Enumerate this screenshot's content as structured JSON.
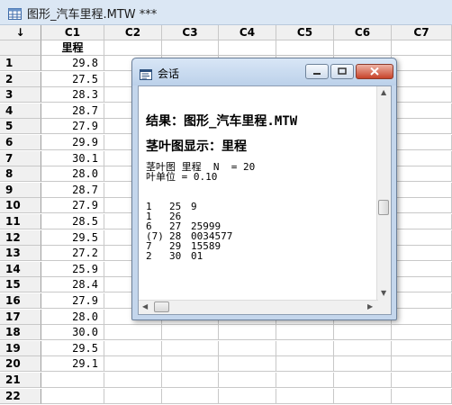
{
  "window": {
    "title": "图形_汽车里程.MTW ***"
  },
  "worksheet": {
    "corner_label": "↓",
    "columns": [
      "C1",
      "C2",
      "C3",
      "C4",
      "C5",
      "C6",
      "C7"
    ],
    "column_names": [
      "里程",
      "",
      "",
      "",
      "",
      "",
      ""
    ],
    "row_numbers": [
      "1",
      "2",
      "3",
      "4",
      "5",
      "6",
      "7",
      "8",
      "9",
      "10",
      "11",
      "12",
      "13",
      "14",
      "15",
      "16",
      "17",
      "18",
      "19",
      "20",
      "21",
      "22"
    ],
    "c1_values": [
      "29.8",
      "27.5",
      "28.3",
      "28.7",
      "27.9",
      "29.9",
      "30.1",
      "28.0",
      "28.7",
      "27.9",
      "28.5",
      "29.5",
      "27.2",
      "25.9",
      "28.4",
      "27.9",
      "28.0",
      "30.0",
      "29.5",
      "29.1",
      "",
      ""
    ]
  },
  "session_window": {
    "title": "会话",
    "result_heading": "结果：图形_汽车里程.MTW",
    "display_heading": "茎叶图显示：里程",
    "plot_header": "茎叶图 里程  N  = 20",
    "leaf_unit": "叶单位 = 0.10",
    "rows": [
      {
        "depth": "1",
        "stem": "25",
        "leaves": "9"
      },
      {
        "depth": "1",
        "stem": "26",
        "leaves": ""
      },
      {
        "depth": "6",
        "stem": "27",
        "leaves": "25999"
      },
      {
        "depth": "(7)",
        "stem": "28",
        "leaves": "0034577"
      },
      {
        "depth": "7",
        "stem": "29",
        "leaves": "15589"
      },
      {
        "depth": "2",
        "stem": "30",
        "leaves": "01"
      }
    ],
    "buttons": {
      "minimize_icon": "minimize-icon",
      "maximize_icon": "maximize-icon",
      "close_icon": "close-icon"
    }
  },
  "colors": {
    "title_bar": "#dbe7f4",
    "header_bg": "#f0f0f0",
    "grid_line": "#c8c8c8",
    "dialog_frame": "#c4d6ec",
    "close_button": "#c7432a"
  }
}
